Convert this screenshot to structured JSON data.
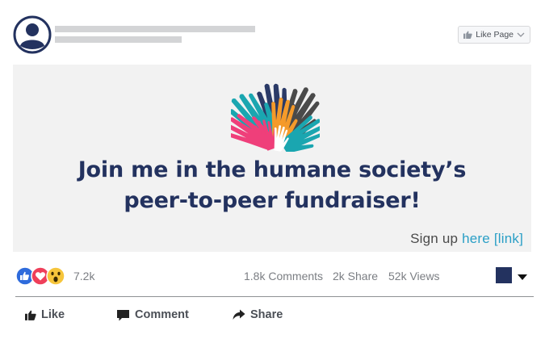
{
  "header": {
    "like_page_label": "Like Page"
  },
  "banner": {
    "headline_line1": "Join me in the humane society’s",
    "headline_line2": "peer-to-peer fundraiser!",
    "signup_text": "Sign up",
    "signup_link": "here [link]",
    "hand_colors": [
      "#2b3a67",
      "#1aa6b0",
      "#ef3f7a",
      "#f59a2a",
      "#4a4a4a"
    ]
  },
  "stats": {
    "reaction_count": "7.2k",
    "comments": "1.8k Comments",
    "shares": "2k Share",
    "views": "52k Views",
    "accent_color": "#23325f"
  },
  "actions": {
    "like": "Like",
    "comment": "Comment",
    "share": "Share"
  }
}
